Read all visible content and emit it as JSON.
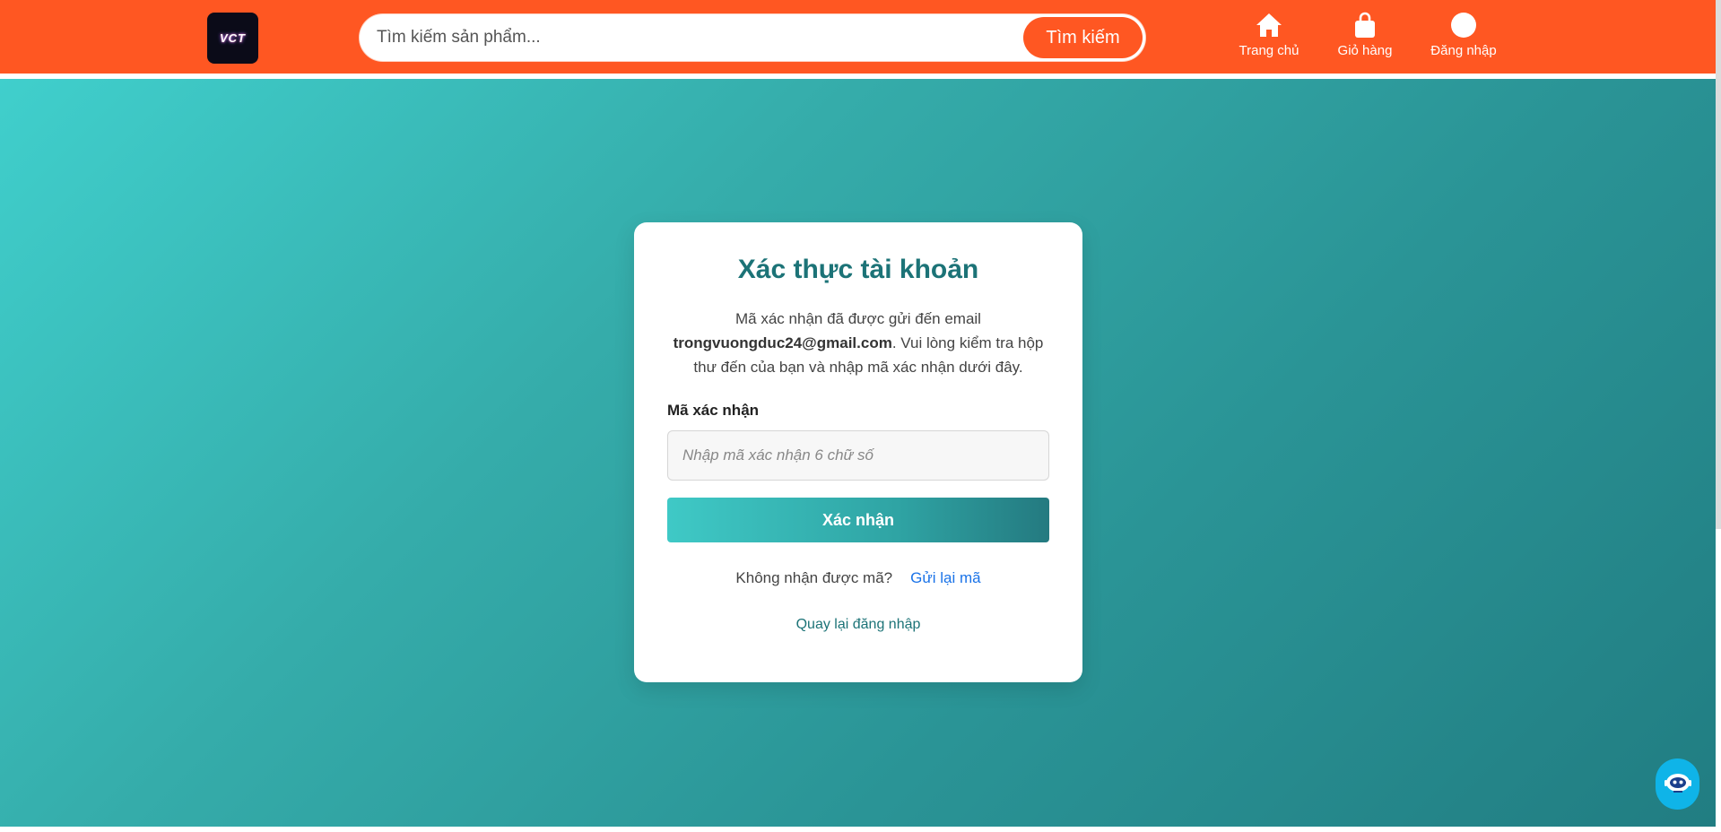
{
  "header": {
    "logo_text": "VCT",
    "search": {
      "placeholder": "Tìm kiếm sản phẩm...",
      "button_label": "Tìm kiếm"
    },
    "nav": {
      "home": "Trang chủ",
      "cart": "Giỏ hàng",
      "login": "Đăng nhập"
    }
  },
  "verify": {
    "title": "Xác thực tài khoản",
    "desc_prefix": "Mã xác nhận đã được gửi đến email",
    "email": "trongvuongduc24@gmail.com",
    "desc_suffix": ". Vui lòng kiểm tra hộp thư đến của bạn và nhập mã xác nhận dưới đây.",
    "code_label": "Mã xác nhận",
    "code_placeholder": "Nhập mã xác nhận 6 chữ số",
    "submit_label": "Xác nhận",
    "resend_prompt": "Không nhận được mã?",
    "resend_link": "Gửi lại mã",
    "back_link": "Quay lại đăng nhập"
  },
  "colors": {
    "header": "#ff5722",
    "title": "#1c7377",
    "link": "#1a73e8",
    "gradient_start": "#40cfcc",
    "gradient_end": "#217d82",
    "chat": "#0fb4e8"
  },
  "icons": {
    "home": "home-icon",
    "cart": "shopping-bag-icon",
    "login": "user-circle-icon",
    "chat": "chatbot-icon"
  }
}
